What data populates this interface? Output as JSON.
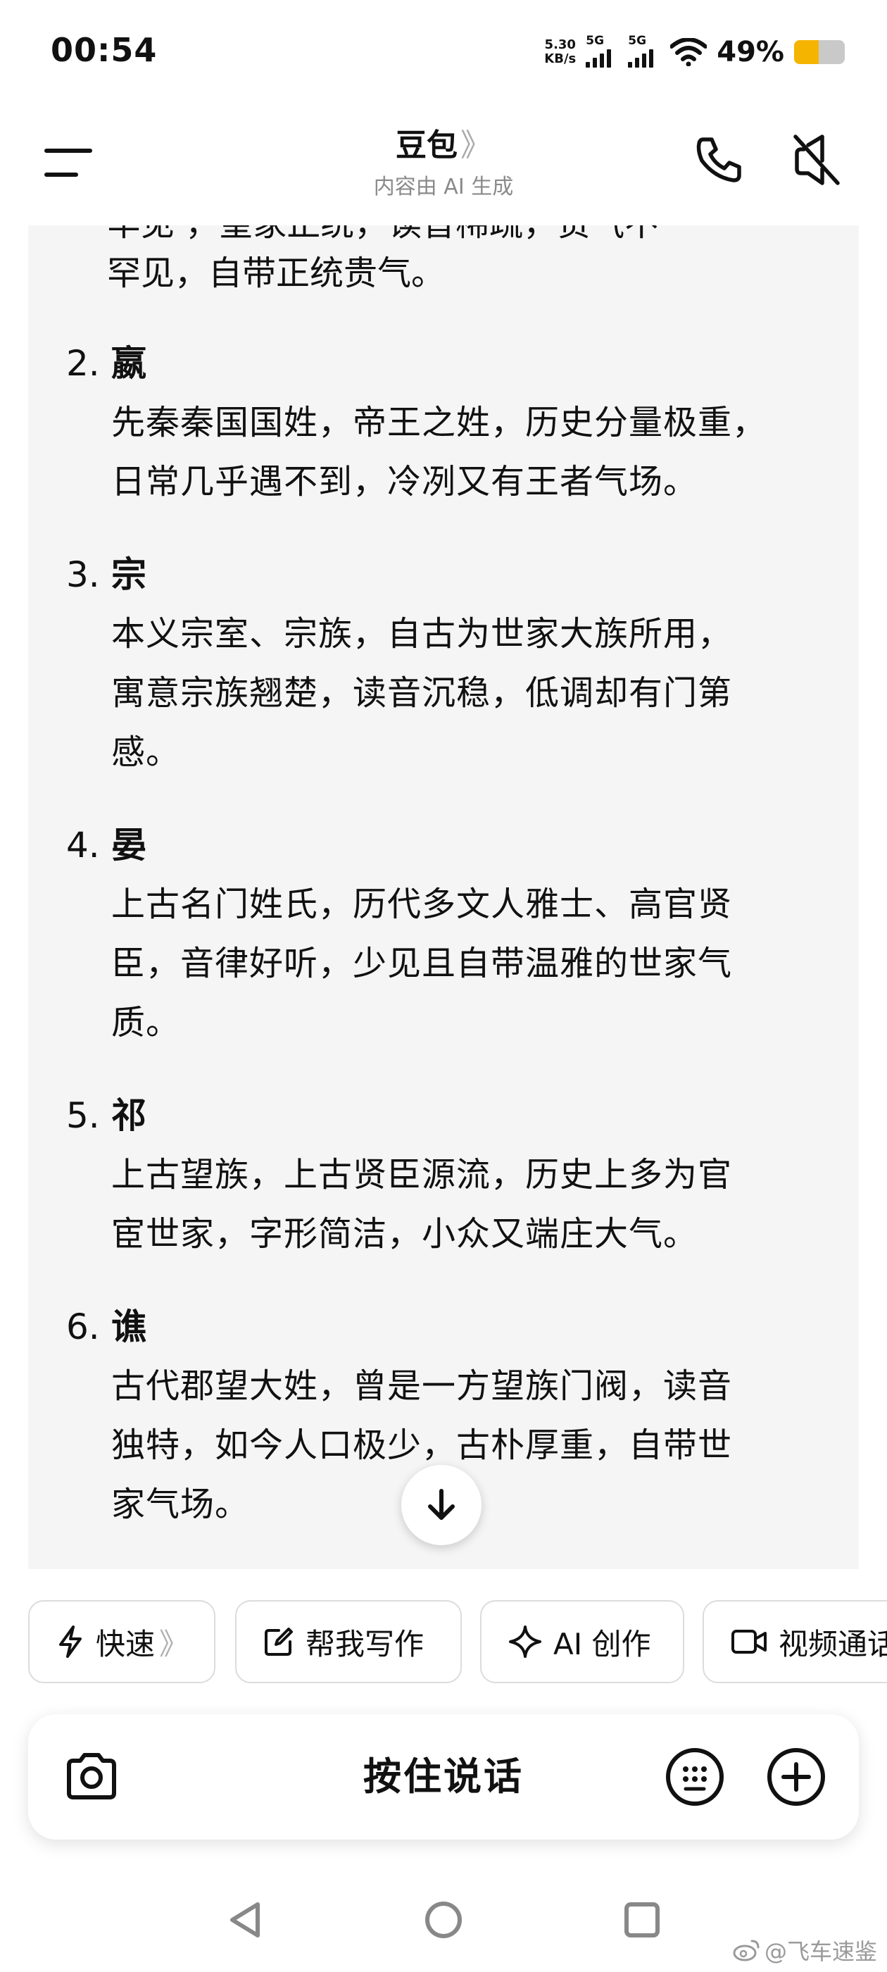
{
  "status_bar": {
    "time": "00:54",
    "net_speed_value": "5.30",
    "net_speed_unit": "KB/s",
    "sim1_type": "5G",
    "sim2_type": "5G",
    "battery_percent": "49%",
    "battery_level": 0.49,
    "battery_color": "#f5b400"
  },
  "header": {
    "title": "豆包",
    "title_chevron": "》",
    "subtitle": "内容由 AI 生成"
  },
  "chat": {
    "partial_line_cut": "罕见·，皇家正统，读音稀疏，贵气不",
    "partial_line": "罕见，自带正统贵气。",
    "entries": [
      {
        "number": "2.",
        "surname": "嬴",
        "desc_lines": [
          "先秦秦国国姓，帝王之姓，历史分量极重，",
          "日常几乎遇不到，冷冽又有王者气场。"
        ]
      },
      {
        "number": "3.",
        "surname": "宗",
        "desc_lines": [
          "本义宗室、宗族，自古为世家大族所用，",
          "寓意宗族翘楚，读音沉稳，低调却有门第",
          "感。"
        ]
      },
      {
        "number": "4.",
        "surname": "晏",
        "desc_lines": [
          "上古名门姓氏，历代多文人雅士、高官贤",
          "臣，音律好听，少见且自带温雅的世家气",
          "质。"
        ]
      },
      {
        "number": "5.",
        "surname": "祁",
        "desc_lines": [
          "上古望族，上古贤臣源流，历史上多为官",
          "宦世家，字形简洁，小众又端庄大气。"
        ]
      },
      {
        "number": "6.",
        "surname": "谯",
        "desc_lines": [
          "古代郡望大姓，曾是一方望族门阀，读音",
          "独特，如今人口极少，古朴厚重，自带世",
          "家气场。"
        ]
      }
    ]
  },
  "quick_actions": [
    {
      "label": "快速",
      "icon": "lightning-icon",
      "chevron": "》"
    },
    {
      "label": "帮我写作",
      "icon": "edit-icon"
    },
    {
      "label": "AI 创作",
      "icon": "sparkle-icon"
    },
    {
      "label": "视频通话",
      "icon": "video-icon"
    }
  ],
  "input_bar": {
    "hold_to_talk": "按住说话"
  },
  "watermark": "@飞车速鉴"
}
